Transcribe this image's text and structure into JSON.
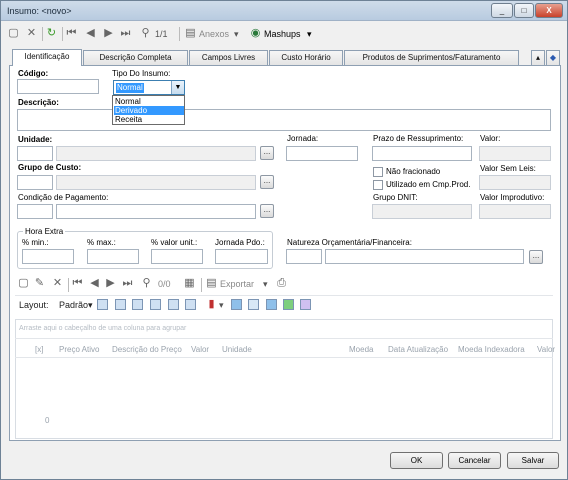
{
  "window": {
    "title": "Insumo: <novo>",
    "controls": {
      "minimize": "_",
      "restore": "□",
      "close": "X"
    }
  },
  "toolbar": {
    "page_count": "1/1",
    "anexos_label": "Anexos",
    "mashups_label": "Mashups"
  },
  "tabs": [
    {
      "label": "Identificação"
    },
    {
      "label": "Descrição Completa"
    },
    {
      "label": "Campos Livres"
    },
    {
      "label": "Custo Horário"
    },
    {
      "label": "Produtos de Suprimentos/Faturamento"
    }
  ],
  "form": {
    "codigo_label": "Código:",
    "tipo_label": "Tipo Do Insumo:",
    "tipo_value": "Normal",
    "tipo_options": [
      "Normal",
      "Derivado",
      "Receita"
    ],
    "tipo_highlighted": "Derivado",
    "descricao_label": "Descrição:",
    "unidade_label": "Unidade:",
    "jornada_label": "Jornada:",
    "prazo_label": "Prazo de Ressuprimento:",
    "valor_label": "Valor:",
    "grupo_custo_label": "Grupo de Custo:",
    "nao_fracionado_label": "Não fracionado",
    "utilizado_label": "Utilizado em Cmp.Prod.",
    "valor_sem_leis_label": "Valor Sem Leis:",
    "condicao_label": "Condição de Pagamento:",
    "grupo_dnit_label": "Grupo DNIT:",
    "valor_improdutivo_label": "Valor Improdutivo:",
    "hora_extra_label": "Hora Extra",
    "pct_min_label": "% min.:",
    "pct_max_label": "% max.:",
    "pct_valor_unit_label": "% valor unit.:",
    "jornada_pdo_label": "Jornada Pdo.:",
    "natureza_label": "Natureza Orçamentária/Financeira:",
    "ellipsis": "..."
  },
  "subtoolbar": {
    "page_count": "0/0",
    "exportar_label": "Exportar"
  },
  "gridtoolbar": {
    "layout_label": "Layout:",
    "padrao_label": "Padrão"
  },
  "grid": {
    "group_hint": "Arraste aqui o cabeçalho de uma coluna para agrupar",
    "columns": [
      "[x]",
      "Preço Ativo",
      "Descrição do Preço",
      "Valor",
      "Unidade",
      "Moeda",
      "Data Atualização",
      "Moeda Indexadora",
      "Valor"
    ],
    "footer_count": "0"
  },
  "buttons": {
    "ok": "OK",
    "cancel": "Cancelar",
    "save": "Salvar"
  }
}
